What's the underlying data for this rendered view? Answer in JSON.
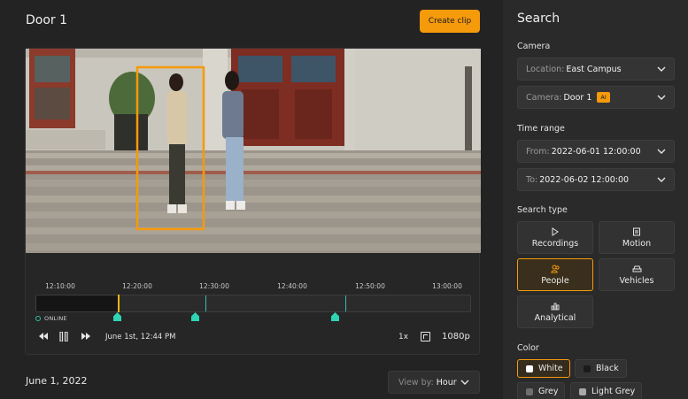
{
  "header": {
    "title": "Door 1",
    "create_clip_label": "Create clip"
  },
  "timeline": {
    "ticks": [
      "12:10:00",
      "12:20:00",
      "12:30:00",
      "12:40:00",
      "12:50:00",
      "13:00:00"
    ],
    "status": "ONLINE",
    "timestamp": "June 1st, 12:44 PM",
    "speed": "1x",
    "quality": "1080p",
    "colors": {
      "event": "#2fd3b4",
      "playhead": "#f2b417"
    }
  },
  "footer": {
    "date": "June 1, 2022",
    "view_by_label": "View by:",
    "view_by_value": "Hour"
  },
  "search": {
    "title": "Search",
    "camera_label": "Camera",
    "location_prefix": "Location:",
    "location_value": "East Campus",
    "camera_prefix": "Camera:",
    "camera_value": "Door 1",
    "ai_badge": "AI",
    "time_range_label": "Time range",
    "from_prefix": "From:",
    "from_value": "2022-06-01 12:00:00",
    "to_prefix": "To:",
    "to_value": "2022-06-02 12:00:00",
    "search_type_label": "Search type",
    "types": {
      "recordings": "Recordings",
      "motion": "Motion",
      "people": "People",
      "vehicles": "Vehicles",
      "analytical": "Analytical"
    },
    "selected_type": "People",
    "color_label": "Color",
    "colors": {
      "white": "White",
      "black": "Black",
      "grey": "Grey",
      "light_grey": "Light Grey"
    },
    "selected_color": "White",
    "accent": "#f59a0b"
  }
}
